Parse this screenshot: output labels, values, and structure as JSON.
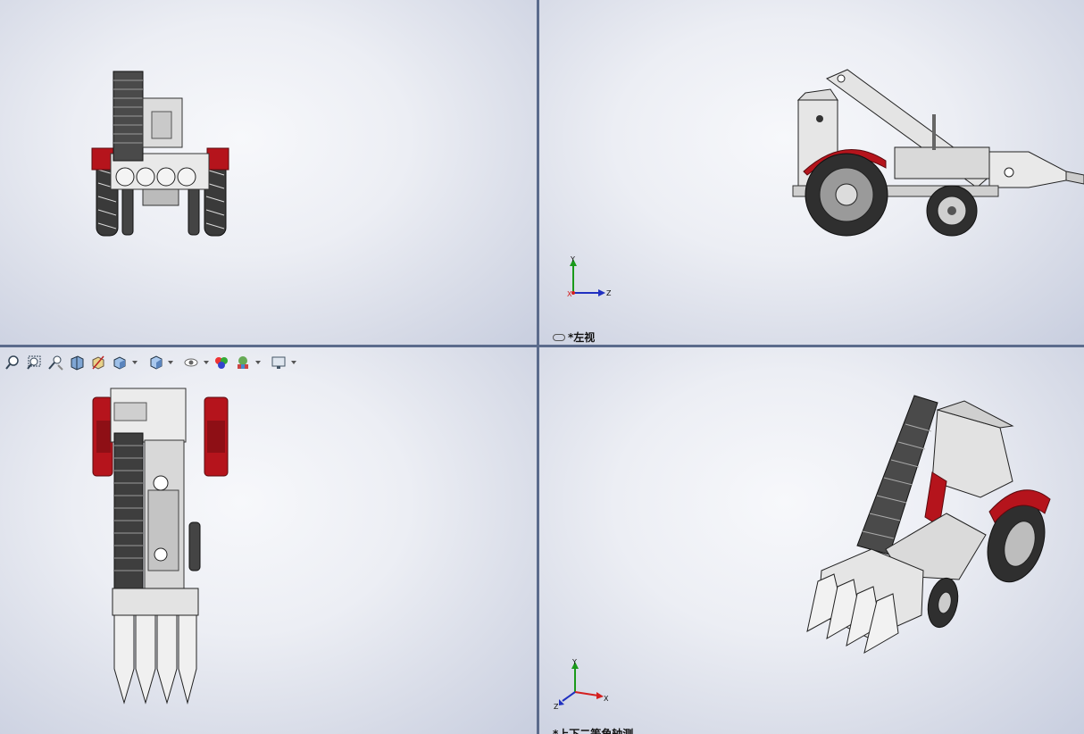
{
  "viewports": {
    "front": {
      "name": "front"
    },
    "left": {
      "label": "*左视"
    },
    "top": {
      "name": "top"
    },
    "iso": {
      "label": "*上下二等角轴测"
    }
  },
  "triad": {
    "x": "X",
    "y": "Y",
    "z": "Z"
  },
  "toolbar": {
    "items": [
      "zoom-to-fit-icon",
      "zoom-to-area-icon",
      "previous-view-icon",
      "section-view-icon",
      "view-orientation-icon",
      "display-style-icon",
      "hide-show-items-icon",
      "edit-appearance-icon",
      "apply-scene-icon",
      "view-settings-icon"
    ]
  },
  "colors": {
    "accent_red": "#b5141c",
    "viewport_border": "#5b6b8c",
    "axis_x": "#d42020",
    "axis_y": "#1a9a1a",
    "axis_z": "#2030c0"
  }
}
